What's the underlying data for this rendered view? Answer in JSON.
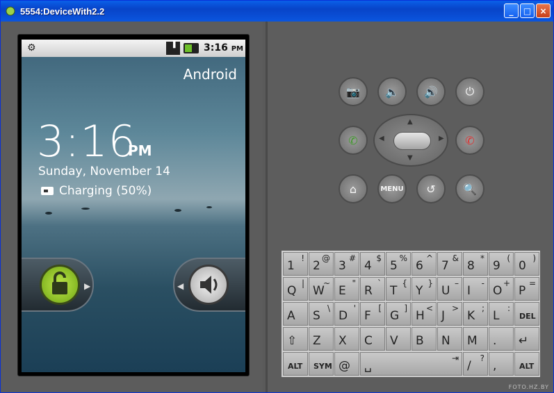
{
  "window": {
    "title": "5554:DeviceWith2.2"
  },
  "statusbar": {
    "time": "3:16",
    "ampm": "PM"
  },
  "lockscreen": {
    "carrier": "Android",
    "clock": "3:16",
    "ampm": "PM",
    "date": "Sunday, November 14",
    "charging": "Charging (50%)"
  },
  "hardware": {
    "menu_label": "MENU"
  },
  "keyboard": {
    "rows": [
      [
        [
          "1",
          "!"
        ],
        [
          "2",
          "@"
        ],
        [
          "3",
          "#"
        ],
        [
          "4",
          "$"
        ],
        [
          "5",
          "%"
        ],
        [
          "6",
          "^"
        ],
        [
          "7",
          "&"
        ],
        [
          "8",
          "*"
        ],
        [
          "9",
          "("
        ],
        [
          "0",
          ")"
        ]
      ],
      [
        [
          "Q",
          "|"
        ],
        [
          "W",
          "~"
        ],
        [
          "E",
          "\""
        ],
        [
          "R",
          "`"
        ],
        [
          "T",
          "{"
        ],
        [
          "Y",
          "}"
        ],
        [
          "U",
          "–"
        ],
        [
          "I",
          "-"
        ],
        [
          "O",
          "+"
        ],
        [
          "P",
          "="
        ]
      ],
      [
        [
          "A",
          ""
        ],
        [
          "S",
          "\\"
        ],
        [
          "D",
          "'"
        ],
        [
          "F",
          "["
        ],
        [
          "G",
          "]"
        ],
        [
          "H",
          "<"
        ],
        [
          "J",
          ">"
        ],
        [
          "K",
          ";"
        ],
        [
          "L",
          ":"
        ],
        [
          "DEL",
          ""
        ]
      ],
      [
        [
          "⇧",
          ""
        ],
        [
          "Z",
          ""
        ],
        [
          "X",
          ""
        ],
        [
          "C",
          ""
        ],
        [
          "V",
          ""
        ],
        [
          "B",
          ""
        ],
        [
          "N",
          ""
        ],
        [
          "M",
          ""
        ],
        [
          ".",
          ""
        ],
        [
          "↵",
          ""
        ]
      ],
      [
        [
          "ALT",
          ""
        ],
        [
          "SYM",
          ""
        ],
        [
          "@",
          ""
        ],
        [
          "␣",
          "⇥"
        ],
        [
          "/",
          "?"
        ],
        [
          ",",
          ""
        ],
        [
          "ALT",
          ""
        ]
      ]
    ]
  },
  "watermark": "FOTO.HZ.BY"
}
